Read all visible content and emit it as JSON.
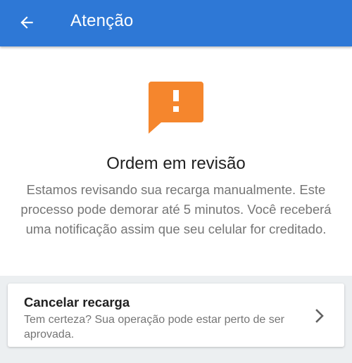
{
  "header": {
    "title": "Atenção",
    "back_icon": "arrow-back-icon",
    "background": "#2e78d6"
  },
  "status": {
    "icon": "alert-message-icon",
    "icon_color": "#f5862d",
    "title": "Ordem em revisão",
    "description": "Estamos revisando sua recarga manualmente. Este processo pode demorar até 5 minutos. Você receberá uma notificação assim que seu celular for creditado."
  },
  "cancel_card": {
    "title": "Cancelar recarga",
    "subtitle": "Tem certeza? Sua operação pode estar perto de ser aprovada.",
    "chevron_icon": "chevron-right-icon"
  }
}
